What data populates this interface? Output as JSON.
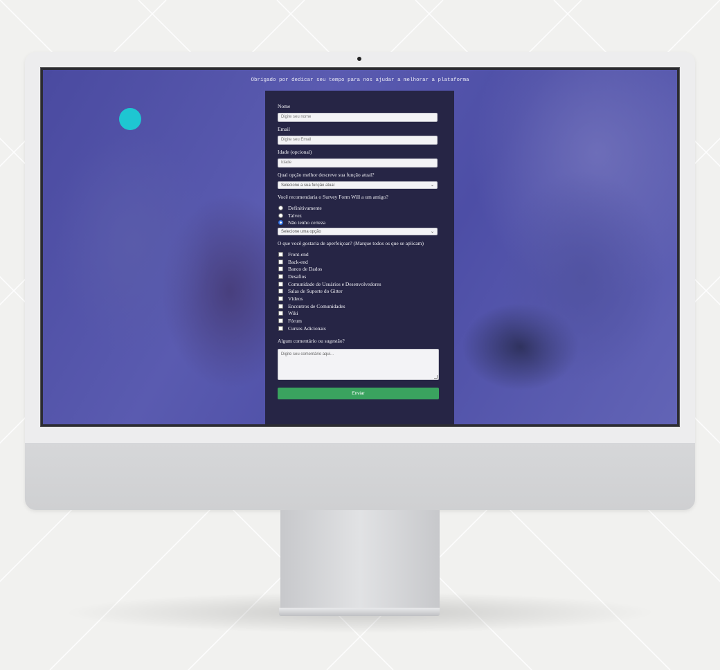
{
  "page": {
    "subtitle": "Obrigado por dedicar seu tempo para nos ajudar a melhorar a plataforma"
  },
  "form": {
    "name": {
      "label": "Nome",
      "placeholder": "Digite seu nome"
    },
    "email": {
      "label": "Email",
      "placeholder": "Digite seu Email"
    },
    "age": {
      "label": "Idade (opcional)",
      "placeholder": "Idade"
    },
    "role": {
      "label": "Qual opção melhor descreve sua função atual?",
      "selected": "Selecione a sua função atual"
    },
    "recommend": {
      "label": "Você recomendaria o Survey Form Will a um amigo?",
      "options": [
        "Definitivamente",
        "Talvez",
        "Não tenho certeza"
      ],
      "selected_index": 2,
      "select_value": "Selecione uma opção"
    },
    "improve": {
      "label": "O que você gostaria de aperfeiçoar? (Marque todos os que se aplicam)",
      "options": [
        "Front-end",
        "Back-end",
        "Banco de Dados",
        "Desafios",
        "Comunidade de Usuários e Desenvolvedores",
        "Salas de Suporte do Gitter",
        "Vídeos",
        "Encontros de Comunidades",
        "Wiki",
        "Fórum",
        "Cursos Adicionais"
      ]
    },
    "comments": {
      "label": "Algum comentário ou sugestão?",
      "placeholder": "Digite seu comentário aqui..."
    },
    "submit_label": "Enviar"
  },
  "colors": {
    "accent_dot": "#1ec6d2",
    "form_bg": "#262545",
    "submit_bg": "#3aa35f",
    "overlay": "#4a4b9e"
  }
}
